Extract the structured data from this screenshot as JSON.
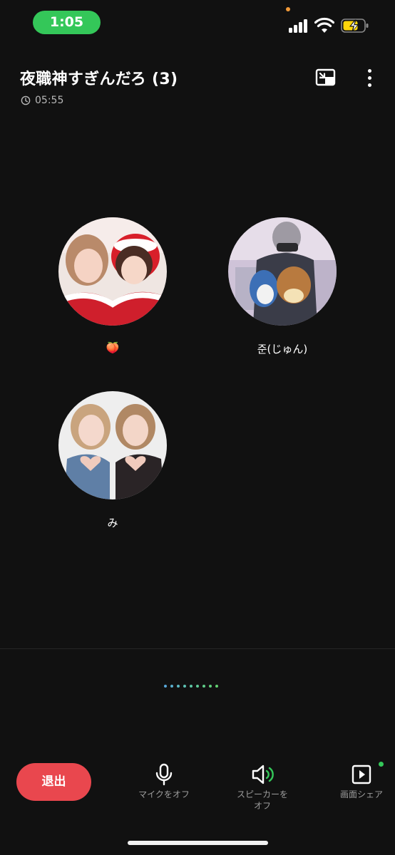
{
  "status_bar": {
    "time": "1:05",
    "icons": [
      "signal-icon",
      "wifi-icon",
      "battery-charging-icon"
    ],
    "time_pill_color": "#34c759"
  },
  "header": {
    "title": "夜職神すぎんだろ (3)",
    "duration": "05:55",
    "icons": [
      "clock-icon",
      "picture-in-picture-icon",
      "more-vertical-icon"
    ]
  },
  "participants": [
    {
      "name": "🍑"
    },
    {
      "name": "준(じゅん)"
    },
    {
      "name": "み"
    }
  ],
  "page_indicator": {
    "count": 9,
    "colors": [
      "#58a7d9",
      "#5ab0cf",
      "#5bb9c2",
      "#5cc1b3",
      "#5dc6a4",
      "#5ec996",
      "#5fcc88",
      "#60ce7c",
      "#62d06f"
    ]
  },
  "controls": {
    "leave_label": "退出",
    "leave_color": "#e9474e",
    "mic_label": "マイクをオフ",
    "speaker_label_1": "スピーカーを",
    "speaker_label_2": "オフ",
    "screen_share_label": "画面シェア",
    "icons": [
      "microphone-icon",
      "speaker-icon",
      "screen-share-icon"
    ],
    "accent": "#34c759"
  }
}
